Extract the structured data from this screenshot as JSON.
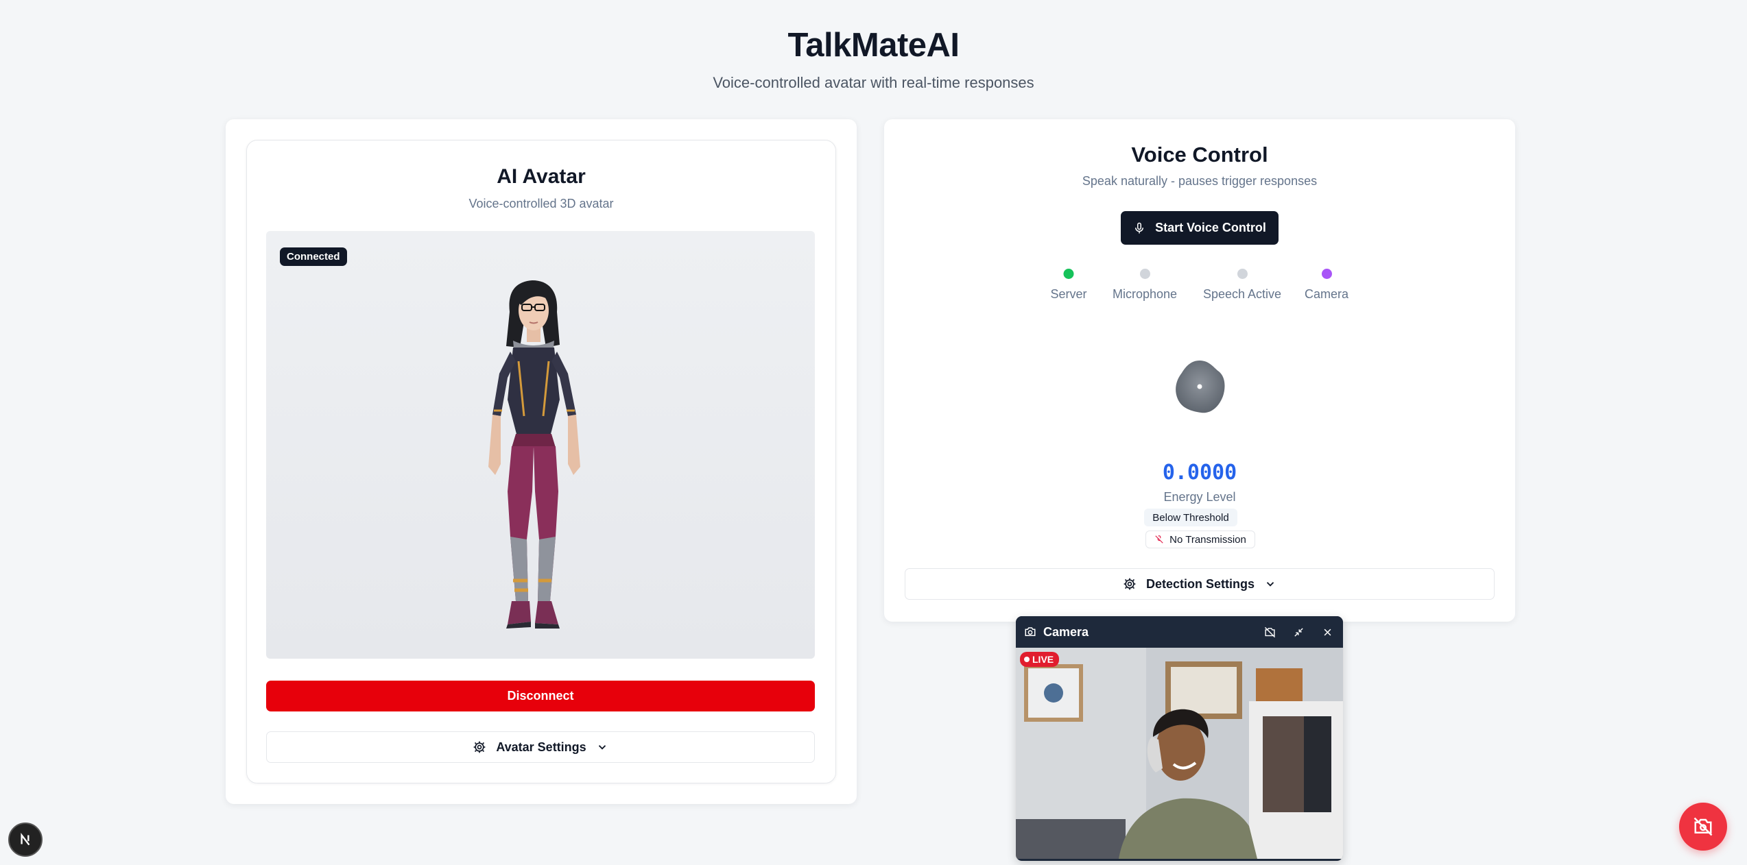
{
  "header": {
    "title": "TalkMateAI",
    "subtitle": "Voice-controlled avatar with real-time responses"
  },
  "avatar_card": {
    "title": "AI Avatar",
    "subtitle": "Voice-controlled 3D avatar",
    "status_badge": "Connected",
    "disconnect_label": "Disconnect",
    "settings_label": "Avatar Settings"
  },
  "voice_card": {
    "title": "Voice Control",
    "subtitle": "Speak naturally - pauses trigger responses",
    "start_label": "Start Voice Control",
    "statuses": [
      {
        "label": "Server",
        "color": "#16c25a"
      },
      {
        "label": "Microphone",
        "color": "#d1d5db"
      },
      {
        "label": "Speech Active",
        "color": "#d1d5db"
      },
      {
        "label": "Camera",
        "color": "#a855f7"
      }
    ],
    "energy_value": "0.0000",
    "energy_label": "Energy Level",
    "threshold_label": "Below Threshold",
    "transmission_label": "No Transmission",
    "settings_label": "Detection Settings"
  },
  "camera_widget": {
    "title": "Camera",
    "live_label": "LIVE"
  },
  "colors": {
    "accent_dark": "#111827",
    "danger": "#e7000b",
    "energy_blue": "#2563eb",
    "fab_red": "#ef3340"
  },
  "icons": {
    "start_button": "mic-icon",
    "settings": "gear-icon",
    "dropdown": "chevron-down-icon",
    "transmission": "mic-off-icon",
    "camera_header": "camera-icon",
    "camera_controls": [
      "camera-off-icon",
      "minimize-icon",
      "close-icon"
    ],
    "fab": "camera-off-icon",
    "bottom_left": "next-logo-icon"
  }
}
